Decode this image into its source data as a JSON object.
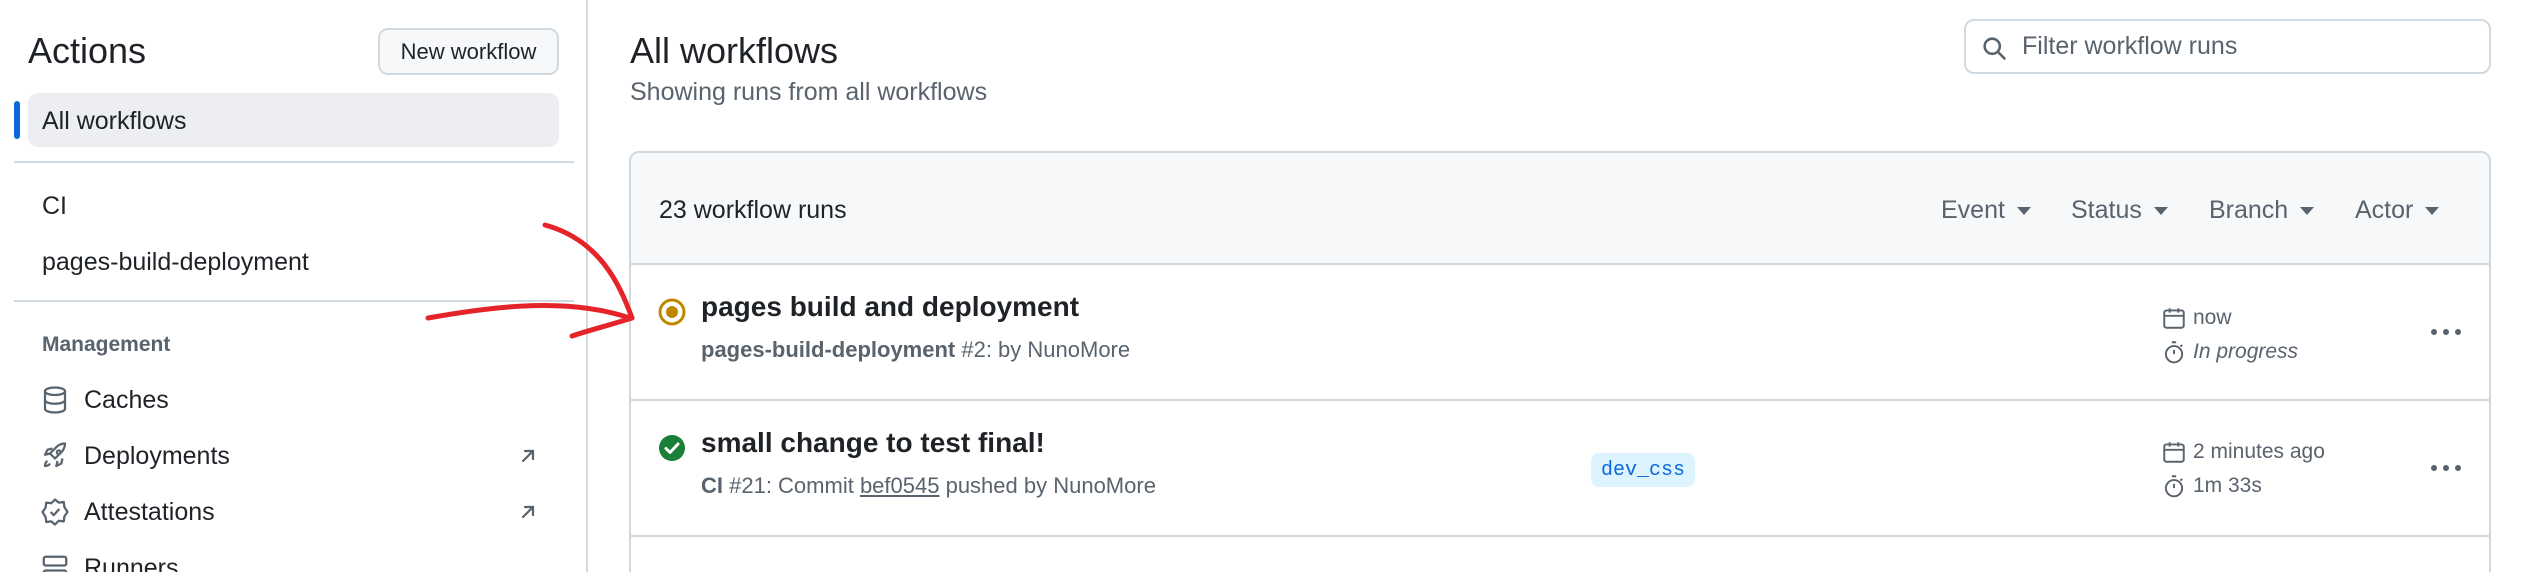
{
  "sidebar": {
    "title": "Actions",
    "new_workflow_label": "New workflow",
    "active_item": "All workflows",
    "workflows": [
      "CI",
      "pages-build-deployment"
    ],
    "management_label": "Management",
    "management_items": [
      {
        "label": "Caches",
        "icon": "database-icon",
        "external": false
      },
      {
        "label": "Deployments",
        "icon": "rocket-icon",
        "external": true
      },
      {
        "label": "Attestations",
        "icon": "shield-check-icon",
        "external": true
      },
      {
        "label": "Runners",
        "icon": "server-icon",
        "external": false
      }
    ]
  },
  "main": {
    "title": "All workflows",
    "subtitle": "Showing runs from all workflows",
    "filter_placeholder": "Filter workflow runs",
    "runs_count": "23 workflow runs",
    "filters": [
      "Event",
      "Status",
      "Branch",
      "Actor"
    ],
    "runs": [
      {
        "title": "pages build and deployment",
        "workflow": "pages-build-deployment",
        "meta_rest": " #2: by NunoMore",
        "status": "in-progress",
        "time": "now",
        "duration": "In progress",
        "branch": ""
      },
      {
        "title": "small change to test final!",
        "workflow": "CI",
        "meta_pre": " #21: Commit ",
        "commit": "bef0545",
        "meta_post": " pushed by NunoMore",
        "status": "success",
        "time": "2 minutes ago",
        "duration": "1m 33s",
        "branch": "dev_css"
      }
    ]
  },
  "colors": {
    "accent": "#0969da",
    "success": "#1a7f37",
    "in_progress": "#bf8700",
    "annotation": "#e5242a"
  }
}
